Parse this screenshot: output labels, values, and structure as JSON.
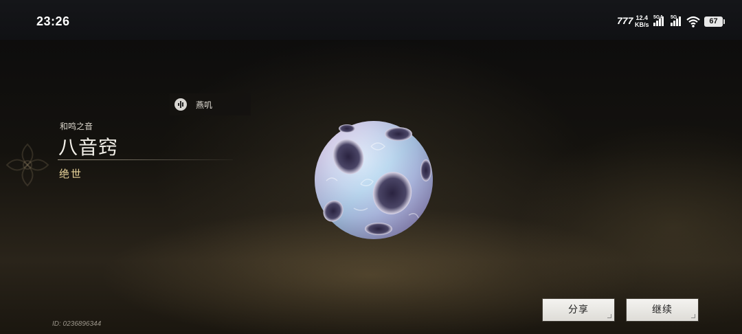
{
  "status_bar": {
    "time": "23:26",
    "network_logo": "777",
    "speed_value": "12.4",
    "speed_unit": "KB/s",
    "signal_1_label": "5GA",
    "signal_2_label": "5G",
    "battery": "67"
  },
  "item": {
    "tag_label": "燕叽",
    "category": "和鸣之音",
    "name": "八音窍",
    "rarity": "绝世",
    "rarity_color": "#e9d49a"
  },
  "actions": {
    "share_label": "分享",
    "continue_label": "继续"
  },
  "footer": {
    "player_id": "ID: 0236896344"
  },
  "icons": [
    "sound-wave-icon",
    "wifi-icon",
    "signal-bars-icon",
    "battery-icon",
    "ornament-icon"
  ]
}
